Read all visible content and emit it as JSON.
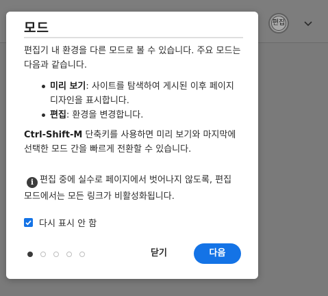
{
  "header": {
    "avatar_label": "편집"
  },
  "dialog": {
    "title": "모드",
    "intro": "편집기 내 환경을 다른 모드로 볼 수 있습니다. 주요 모드는 다음과 같습니다.",
    "modes": [
      {
        "name": "미리 보기",
        "description": ": 사이트를 탐색하여 게시된 이후 페이지 디자인을 표시합니다."
      },
      {
        "name": "편집",
        "description": ": 환경을 변경합니다."
      }
    ],
    "shortcut_key": "Ctrl-Shift-M",
    "shortcut_text": " 단축키를 사용하면 미리 보기와 마지막에 선택한 모드 간을 빠르게 전환할 수 있습니다.",
    "info_text": "편집 중에 실수로 페이지에서 벗어나지 않도록, 편집 모드에서는 모든 링크가 비활성화됩니다.",
    "checkbox_label": "다시 표시 안 함",
    "checkbox_checked": true,
    "pagination": {
      "current": 1,
      "total": 5
    },
    "close_label": "닫기",
    "next_label": "다음"
  },
  "colors": {
    "accent": "#1473e6",
    "backdrop": "#7a7a7a"
  },
  "icons": [
    "info-icon",
    "chevron-down-icon",
    "check-icon"
  ]
}
